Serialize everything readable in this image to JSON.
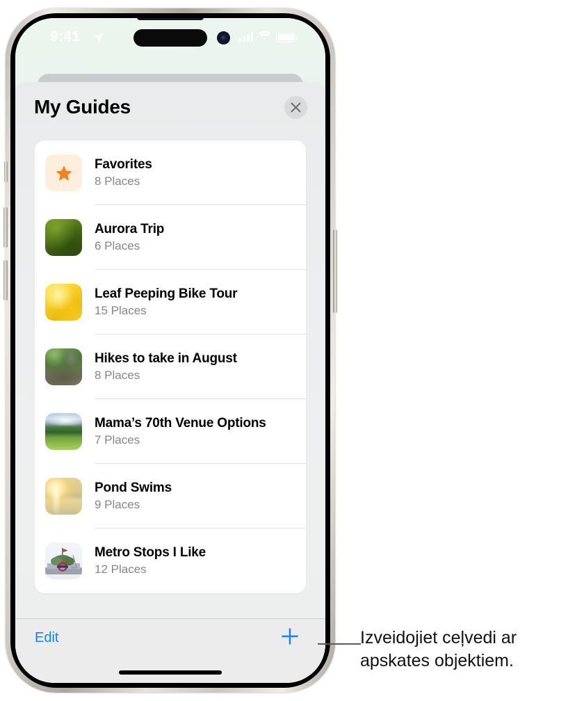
{
  "status_bar": {
    "time": "9:41",
    "location_icon": "location-arrow-icon",
    "cellular_icon": "cellular-bars-icon",
    "wifi_icon": "wifi-icon",
    "battery_icon": "battery-icon"
  },
  "sheet": {
    "title": "My Guides",
    "close_icon": "close-icon"
  },
  "guides": [
    {
      "title": "Favorites",
      "places": "8 Places",
      "thumb": "star-thumbnail",
      "thumb_class": "tb-fav"
    },
    {
      "title": "Aurora Trip",
      "places": "6 Places",
      "thumb": "green-field-thumbnail",
      "thumb_class": "tb-aurora"
    },
    {
      "title": "Leaf Peeping Bike Tour",
      "places": "15 Places",
      "thumb": "yellow-leaves-thumbnail",
      "thumb_class": "tb-leaf"
    },
    {
      "title": "Hikes to take in August",
      "places": "8 Places",
      "thumb": "forest-trail-thumbnail",
      "thumb_class": "tb-hikes"
    },
    {
      "title": "Mama’s 70th Venue Options",
      "places": "7 Places",
      "thumb": "meadow-thumbnail",
      "thumb_class": "tb-mama"
    },
    {
      "title": "Pond Swims",
      "places": "9 Places",
      "thumb": "sunset-water-thumbnail",
      "thumb_class": "tb-pond"
    },
    {
      "title": "Metro Stops I Like",
      "places": "12 Places",
      "thumb": "monument-thumbnail",
      "thumb_class": "tb-metro"
    }
  ],
  "toolbar": {
    "edit_label": "Edit",
    "add_icon": "plus-icon"
  },
  "callout": {
    "text": "Izveidojiet ceļvedi ar apskates objektiem."
  },
  "colors": {
    "accent_blue": "#0a84ff",
    "star_orange": "#f6821f",
    "secondary_text": "#86868b",
    "sheet_bg": "#eceeef",
    "card_bg": "#ffffff"
  }
}
